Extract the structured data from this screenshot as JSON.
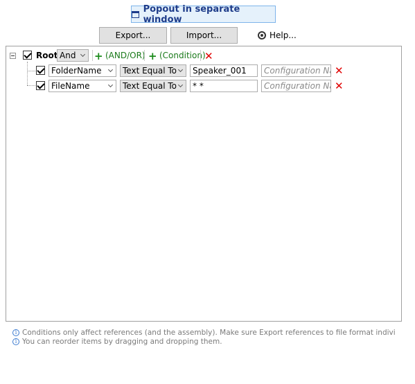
{
  "toolbar": {
    "popout_label": "Popout in separate window",
    "export_label": "Export...",
    "import_label": "Import...",
    "help_label": "Help..."
  },
  "tree": {
    "root": {
      "label": "Root:",
      "operator": "And",
      "add_group_label": "(AND/OR)",
      "add_condition_label": "(Condition)"
    },
    "conditions": [
      {
        "field": "FolderName",
        "comparison": "Text Equal To",
        "value": "Speaker_001",
        "config_placeholder": "Configuration Name"
      },
      {
        "field": "FileName",
        "comparison": "Text Equal To",
        "value": "* *",
        "config_placeholder": "Configuration Name"
      }
    ]
  },
  "notes": [
    "Conditions only affect references (and the assembly). Make sure Export references to file format individually is ch",
    "You can reorder items by dragging and dropping them."
  ],
  "icons": {
    "add": "plus-icon",
    "delete": "red-x-icon",
    "info": "info-icon",
    "help": "lifebuoy-icon",
    "popout": "window-icon"
  },
  "colors": {
    "add_green": "#1a8a1a",
    "delete_red": "#e00000",
    "popout_text": "#1e3c8a",
    "info_blue": "#3a7ad0"
  }
}
